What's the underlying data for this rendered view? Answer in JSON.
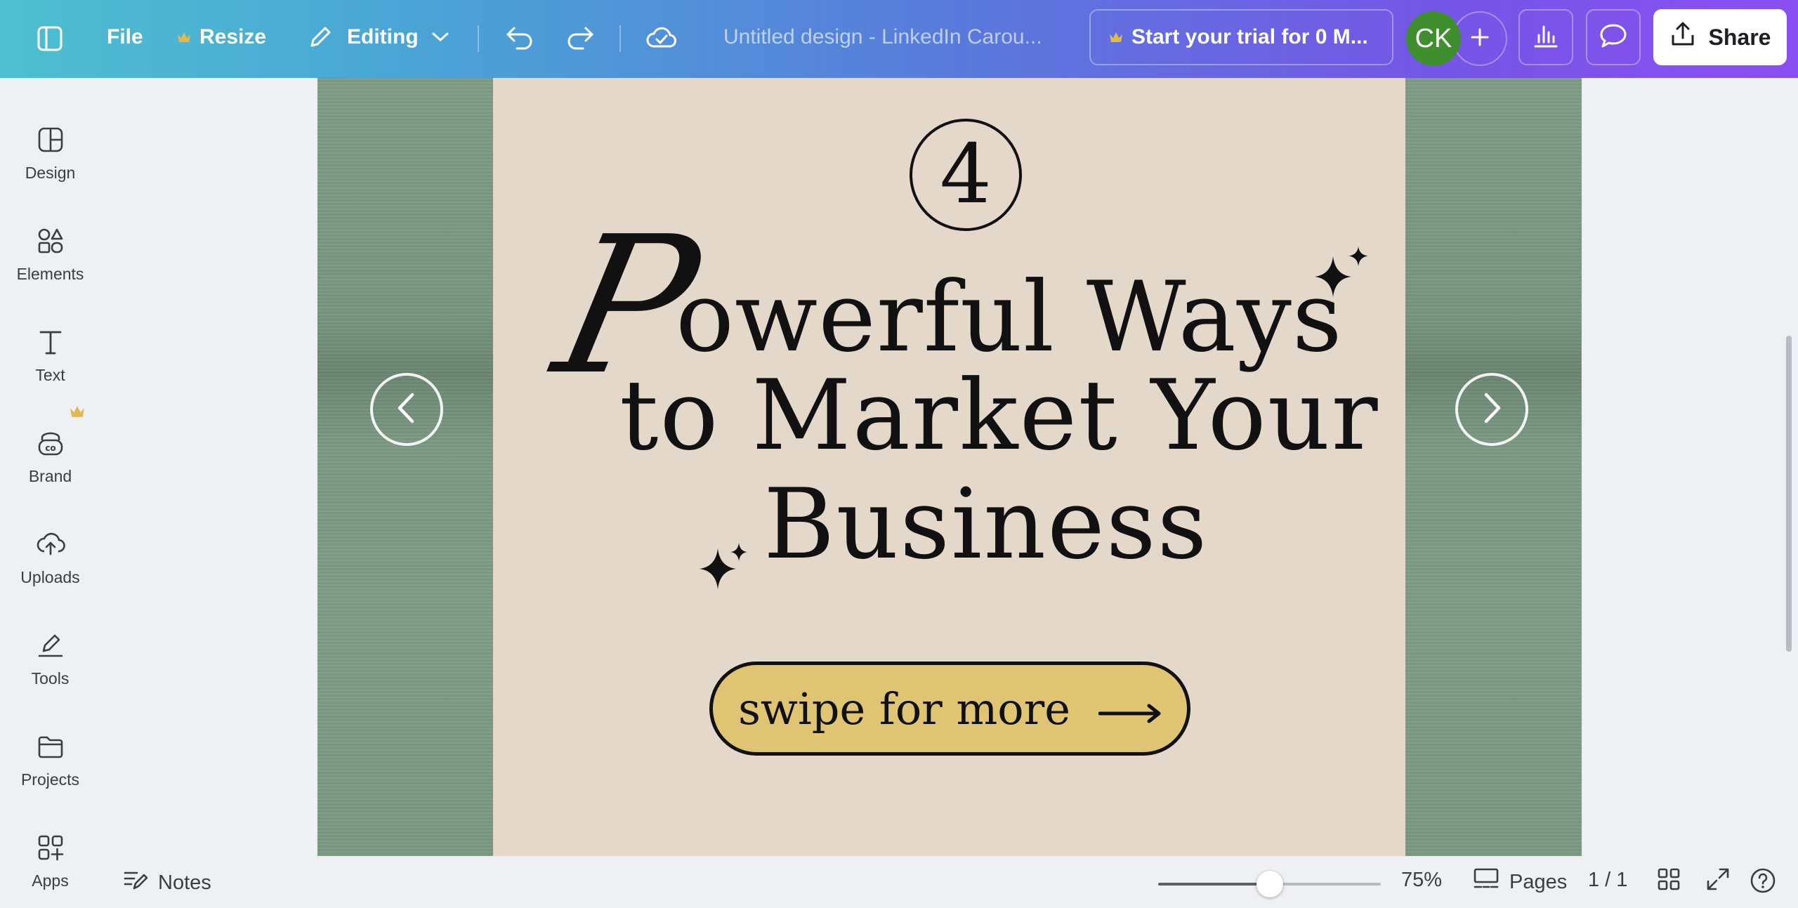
{
  "topbar": {
    "file_label": "File",
    "resize_label": "Resize",
    "editing_label": "Editing",
    "title": "Untitled design - LinkedIn Carou...",
    "trial_label": "Start your trial for 0 M...",
    "avatar_initials": "CK",
    "share_label": "Share"
  },
  "sidebar": {
    "items": [
      {
        "label": "Design",
        "icon": "design-icon"
      },
      {
        "label": "Elements",
        "icon": "elements-icon"
      },
      {
        "label": "Text",
        "icon": "text-icon"
      },
      {
        "label": "Brand",
        "icon": "brand-icon"
      },
      {
        "label": "Uploads",
        "icon": "uploads-icon"
      },
      {
        "label": "Tools",
        "icon": "tools-icon"
      },
      {
        "label": "Projects",
        "icon": "projects-icon"
      },
      {
        "label": "Apps",
        "icon": "apps-icon"
      }
    ]
  },
  "design": {
    "number": "4",
    "script_letter": "P",
    "line1": "owerful Ways",
    "line2": "to Market Your",
    "line3": "Business",
    "button_text": "swipe for more"
  },
  "bottombar": {
    "notes_label": "Notes",
    "zoom_level": "75%",
    "zoom_fraction": 0.5,
    "pages_label": "Pages",
    "page_counter": "1 / 1"
  },
  "colors": {
    "accent_gradient_start": "#4fbfd0",
    "accent_gradient_end": "#8a4ff0",
    "slide_green": "#7d9983",
    "slide_beige": "#e3d8ca",
    "button_yellow": "#dfc573",
    "avatar_green": "#3f8f2e",
    "crown_gold": "#e0b94a"
  }
}
